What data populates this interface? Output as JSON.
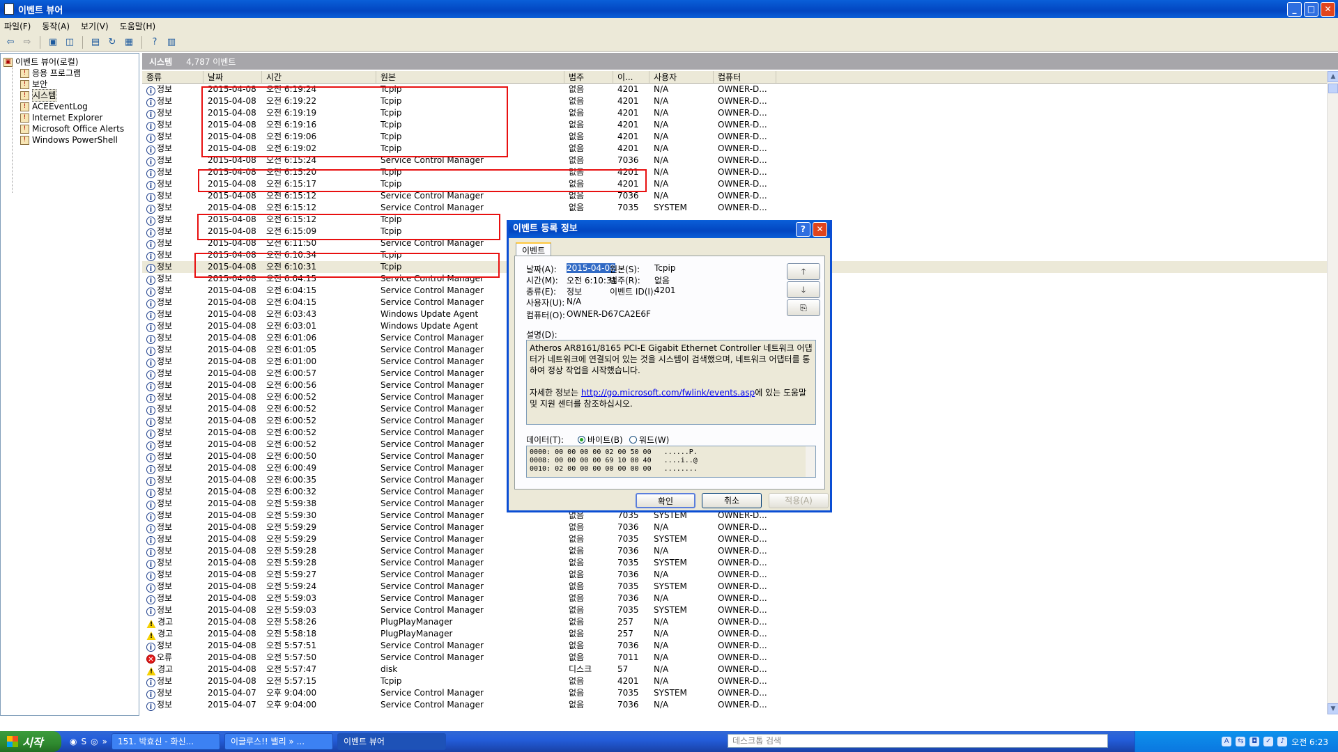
{
  "window": {
    "title": "이벤트 뷰어",
    "min": "_",
    "max": "□",
    "close": "✕"
  },
  "menu": [
    "파일(F)",
    "동작(A)",
    "보기(V)",
    "도움말(H)"
  ],
  "tree": {
    "root": "이벤트 뷰어(로컬)",
    "items": [
      "응용 프로그램",
      "보안",
      "시스템",
      "ACEEventLog",
      "Internet Explorer",
      "Microsoft Office Alerts",
      "Windows PowerShell"
    ]
  },
  "panel": {
    "name": "시스템",
    "count": "4,787 이벤트"
  },
  "columns": [
    "종류",
    "날짜",
    "시간",
    "원본",
    "범주",
    "이...",
    "사용자",
    "컴퓨터"
  ],
  "rows": [
    [
      "정보",
      "2015-04-08",
      "오전 6:19:24",
      "Tcpip",
      "없음",
      "4201",
      "N/A",
      "OWNER-D..."
    ],
    [
      "정보",
      "2015-04-08",
      "오전 6:19:22",
      "Tcpip",
      "없음",
      "4201",
      "N/A",
      "OWNER-D..."
    ],
    [
      "정보",
      "2015-04-08",
      "오전 6:19:19",
      "Tcpip",
      "없음",
      "4201",
      "N/A",
      "OWNER-D..."
    ],
    [
      "정보",
      "2015-04-08",
      "오전 6:19:16",
      "Tcpip",
      "없음",
      "4201",
      "N/A",
      "OWNER-D..."
    ],
    [
      "정보",
      "2015-04-08",
      "오전 6:19:06",
      "Tcpip",
      "없음",
      "4201",
      "N/A",
      "OWNER-D..."
    ],
    [
      "정보",
      "2015-04-08",
      "오전 6:19:02",
      "Tcpip",
      "없음",
      "4201",
      "N/A",
      "OWNER-D..."
    ],
    [
      "정보",
      "2015-04-08",
      "오전 6:15:24",
      "Service Control Manager",
      "없음",
      "7036",
      "N/A",
      "OWNER-D..."
    ],
    [
      "정보",
      "2015-04-08",
      "오전 6:15:20",
      "Tcpip",
      "없음",
      "4201",
      "N/A",
      "OWNER-D..."
    ],
    [
      "정보",
      "2015-04-08",
      "오전 6:15:17",
      "Tcpip",
      "없음",
      "4201",
      "N/A",
      "OWNER-D..."
    ],
    [
      "정보",
      "2015-04-08",
      "오전 6:15:12",
      "Service Control Manager",
      "없음",
      "7036",
      "N/A",
      "OWNER-D..."
    ],
    [
      "정보",
      "2015-04-08",
      "오전 6:15:12",
      "Service Control Manager",
      "없음",
      "7035",
      "SYSTEM",
      "OWNER-D..."
    ],
    [
      "정보",
      "2015-04-08",
      "오전 6:15:12",
      "Tcpip",
      "",
      "",
      "",
      ""
    ],
    [
      "정보",
      "2015-04-08",
      "오전 6:15:09",
      "Tcpip",
      "",
      "",
      "",
      ""
    ],
    [
      "정보",
      "2015-04-08",
      "오전 6:11:50",
      "Service Control Manager",
      "",
      "",
      "",
      ""
    ],
    [
      "정보",
      "2015-04-08",
      "오전 6:10:34",
      "Tcpip",
      "",
      "",
      "",
      ""
    ],
    [
      "정보",
      "2015-04-08",
      "오전 6:10:31",
      "Tcpip",
      "",
      "",
      "",
      ""
    ],
    [
      "정보",
      "2015-04-08",
      "오전 6:04:15",
      "Service Control Manager",
      "",
      "",
      "",
      ""
    ],
    [
      "정보",
      "2015-04-08",
      "오전 6:04:15",
      "Service Control Manager",
      "",
      "",
      "",
      ""
    ],
    [
      "정보",
      "2015-04-08",
      "오전 6:04:15",
      "Service Control Manager",
      "",
      "",
      "",
      ""
    ],
    [
      "정보",
      "2015-04-08",
      "오전 6:03:43",
      "Windows Update Agent",
      "",
      "",
      "",
      ""
    ],
    [
      "정보",
      "2015-04-08",
      "오전 6:03:01",
      "Windows Update Agent",
      "",
      "",
      "",
      ""
    ],
    [
      "정보",
      "2015-04-08",
      "오전 6:01:06",
      "Service Control Manager",
      "",
      "",
      "",
      ""
    ],
    [
      "정보",
      "2015-04-08",
      "오전 6:01:05",
      "Service Control Manager",
      "",
      "",
      "",
      ""
    ],
    [
      "정보",
      "2015-04-08",
      "오전 6:01:00",
      "Service Control Manager",
      "",
      "",
      "",
      ""
    ],
    [
      "정보",
      "2015-04-08",
      "오전 6:00:57",
      "Service Control Manager",
      "",
      "",
      "",
      ""
    ],
    [
      "정보",
      "2015-04-08",
      "오전 6:00:56",
      "Service Control Manager",
      "",
      "",
      "",
      ""
    ],
    [
      "정보",
      "2015-04-08",
      "오전 6:00:52",
      "Service Control Manager",
      "",
      "",
      "",
      ""
    ],
    [
      "정보",
      "2015-04-08",
      "오전 6:00:52",
      "Service Control Manager",
      "",
      "",
      "",
      ""
    ],
    [
      "정보",
      "2015-04-08",
      "오전 6:00:52",
      "Service Control Manager",
      "",
      "",
      "",
      ""
    ],
    [
      "정보",
      "2015-04-08",
      "오전 6:00:52",
      "Service Control Manager",
      "",
      "",
      "",
      ""
    ],
    [
      "정보",
      "2015-04-08",
      "오전 6:00:52",
      "Service Control Manager",
      "",
      "",
      "",
      ""
    ],
    [
      "정보",
      "2015-04-08",
      "오전 6:00:50",
      "Service Control Manager",
      "",
      "",
      "",
      ""
    ],
    [
      "정보",
      "2015-04-08",
      "오전 6:00:49",
      "Service Control Manager",
      "",
      "",
      "",
      ""
    ],
    [
      "정보",
      "2015-04-08",
      "오전 6:00:35",
      "Service Control Manager",
      "",
      "",
      "",
      ""
    ],
    [
      "정보",
      "2015-04-08",
      "오전 6:00:32",
      "Service Control Manager",
      "",
      "",
      "",
      ""
    ],
    [
      "정보",
      "2015-04-08",
      "오전 5:59:38",
      "Service Control Manager",
      "",
      "",
      "",
      ""
    ],
    [
      "정보",
      "2015-04-08",
      "오전 5:59:30",
      "Service Control Manager",
      "없음",
      "7035",
      "SYSTEM",
      "OWNER-D..."
    ],
    [
      "정보",
      "2015-04-08",
      "오전 5:59:29",
      "Service Control Manager",
      "없음",
      "7036",
      "N/A",
      "OWNER-D..."
    ],
    [
      "정보",
      "2015-04-08",
      "오전 5:59:29",
      "Service Control Manager",
      "없음",
      "7035",
      "SYSTEM",
      "OWNER-D..."
    ],
    [
      "정보",
      "2015-04-08",
      "오전 5:59:28",
      "Service Control Manager",
      "없음",
      "7036",
      "N/A",
      "OWNER-D..."
    ],
    [
      "정보",
      "2015-04-08",
      "오전 5:59:28",
      "Service Control Manager",
      "없음",
      "7035",
      "SYSTEM",
      "OWNER-D..."
    ],
    [
      "정보",
      "2015-04-08",
      "오전 5:59:27",
      "Service Control Manager",
      "없음",
      "7036",
      "N/A",
      "OWNER-D..."
    ],
    [
      "정보",
      "2015-04-08",
      "오전 5:59:24",
      "Service Control Manager",
      "없음",
      "7035",
      "SYSTEM",
      "OWNER-D..."
    ],
    [
      "정보",
      "2015-04-08",
      "오전 5:59:03",
      "Service Control Manager",
      "없음",
      "7036",
      "N/A",
      "OWNER-D..."
    ],
    [
      "정보",
      "2015-04-08",
      "오전 5:59:03",
      "Service Control Manager",
      "없음",
      "7035",
      "SYSTEM",
      "OWNER-D..."
    ],
    [
      "경고",
      "2015-04-08",
      "오전 5:58:26",
      "PlugPlayManager",
      "없음",
      "257",
      "N/A",
      "OWNER-D..."
    ],
    [
      "경고",
      "2015-04-08",
      "오전 5:58:18",
      "PlugPlayManager",
      "없음",
      "257",
      "N/A",
      "OWNER-D..."
    ],
    [
      "정보",
      "2015-04-08",
      "오전 5:57:51",
      "Service Control Manager",
      "없음",
      "7036",
      "N/A",
      "OWNER-D..."
    ],
    [
      "오류",
      "2015-04-08",
      "오전 5:57:50",
      "Service Control Manager",
      "없음",
      "7011",
      "N/A",
      "OWNER-D..."
    ],
    [
      "경고",
      "2015-04-08",
      "오전 5:57:47",
      "disk",
      "디스크",
      "57",
      "N/A",
      "OWNER-D..."
    ],
    [
      "정보",
      "2015-04-08",
      "오전 5:57:15",
      "Tcpip",
      "없음",
      "4201",
      "N/A",
      "OWNER-D..."
    ],
    [
      "정보",
      "2015-04-07",
      "오후 9:04:00",
      "Service Control Manager",
      "없음",
      "7035",
      "SYSTEM",
      "OWNER-D..."
    ],
    [
      "정보",
      "2015-04-07",
      "오후 9:04:00",
      "Service Control Manager",
      "없음",
      "7036",
      "N/A",
      "OWNER-D..."
    ]
  ],
  "dialog": {
    "title": "이벤트 등록 정보",
    "help": "?",
    "tab": "이벤트",
    "date_label": "날짜(A):",
    "date": "2015-04-08",
    "source_label": "원본(S):",
    "source": "Tcpip",
    "time_label": "시간(M):",
    "time": "오전 6:10:31",
    "category_label": "범주(R):",
    "category": "없음",
    "type_label": "종류(E):",
    "type": "정보",
    "eventid_label": "이벤트 ID(I):",
    "eventid": "4201",
    "user_label": "사용자(U):",
    "user": "N/A",
    "computer_label": "컴퓨터(O):",
    "computer": "OWNER-D67CA2E6F",
    "desc_label": "설명(D):",
    "desc_text": "Atheros AR8161/8165 PCI-E Gigabit Ethernet Controller 네트워크 어댑터가 네트워크에 연결되어 있는 것을 시스템이 검색했으며, 네트워크 어댑터를 통하여 정상 작업을 시작했습니다.",
    "desc_more_pre": "자세한 정보는 ",
    "desc_link": "http://go.microsoft.com/fwlink/events.asp",
    "desc_more_post": "에 있는 도움말 및 지원 센터를 참조하십시오.",
    "data_label": "데이터(T):",
    "bytes": "바이트(B)",
    "words": "워드(W)",
    "hex": "0000: 00 00 00 00 02 00 50 00   ......P.\n0008: 00 00 00 00 69 10 00 40   ....i..@\n0010: 02 00 00 00 00 00 00 00   ........",
    "up": "🡑",
    "down": "🡓",
    "copy": "⎘",
    "ok": "확인",
    "cancel": "취소",
    "apply": "적용(A)"
  },
  "taskbar": {
    "start": "시작",
    "tasks": [
      "151. 박효신 - 화신...",
      "이글루스!! 밸리 » ...",
      "이벤트 뷰어"
    ],
    "search_placeholder": "데스크톱 검색",
    "clock": "오전 6:23"
  }
}
